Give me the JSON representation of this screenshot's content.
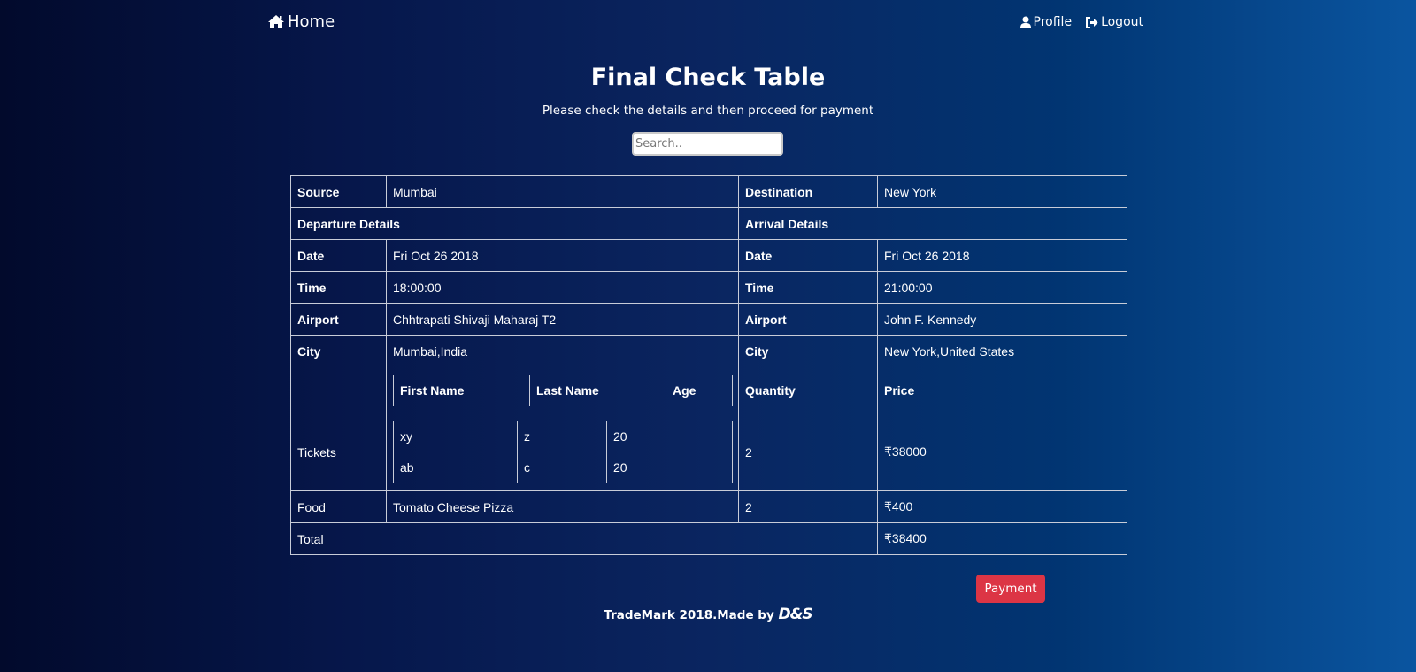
{
  "nav": {
    "home": "Home",
    "profile": "Profile",
    "logout": "Logout"
  },
  "header": {
    "title": "Final Check Table",
    "subtitle": "Please check the details and then proceed for payment"
  },
  "search": {
    "placeholder": "Search.."
  },
  "table": {
    "source_label": "Source",
    "source": "Mumbai",
    "destination_label": "Destination",
    "destination": "New York",
    "departure_heading": "Departure Details",
    "arrival_heading": "Arrival Details",
    "date_label": "Date",
    "dep_date": "Fri Oct 26 2018",
    "arr_date": "Fri Oct 26 2018",
    "time_label": "Time",
    "dep_time": "18:00:00",
    "arr_time": "21:00:00",
    "airport_label": "Airport",
    "dep_airport": "Chhtrapati Shivaji Maharaj T2",
    "arr_airport": "John F. Kennedy",
    "city_label": "City",
    "dep_city": "Mumbai,India",
    "arr_city": "New York,United States",
    "passenger_headers": {
      "first": "First Name",
      "last": "Last Name",
      "age": "Age"
    },
    "quantity_label": "Quantity",
    "price_label": "Price",
    "tickets_label": "Tickets",
    "passengers": [
      {
        "first": "xy",
        "last": "z",
        "age": "20"
      },
      {
        "first": "ab",
        "last": "c",
        "age": "20"
      }
    ],
    "tickets_qty": "2",
    "tickets_price": "₹38000",
    "food_label": "Food",
    "food_item": "Tomato Cheese Pizza",
    "food_qty": "2",
    "food_price": "₹400",
    "total_label": "Total",
    "total_price": "₹38400"
  },
  "payment_button": "Payment",
  "footer": {
    "text": "TradeMark 2018.Made by",
    "logo": "D&S"
  },
  "colors": {
    "accent": "#dc3545",
    "border": "#c8ccd8"
  }
}
